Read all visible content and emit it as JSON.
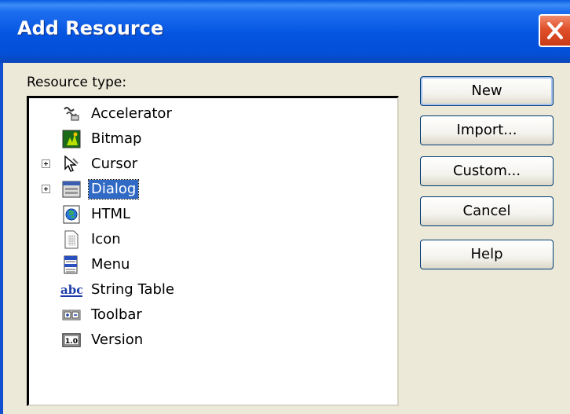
{
  "window": {
    "title": "Add Resource",
    "close_icon": "close-icon",
    "colors": {
      "title_bar": "#0454e0",
      "close": "#e0502a",
      "selection": "#316ac5",
      "face": "#ece9d8"
    }
  },
  "resource_type_label": "Resource type:",
  "tree": {
    "items": [
      {
        "label": "Accelerator",
        "icon": "accelerator-icon",
        "expandable": false,
        "selected": false
      },
      {
        "label": "Bitmap",
        "icon": "bitmap-icon",
        "expandable": false,
        "selected": false
      },
      {
        "label": "Cursor",
        "icon": "cursor-icon",
        "expandable": true,
        "selected": false
      },
      {
        "label": "Dialog",
        "icon": "dialog-icon",
        "expandable": true,
        "selected": true
      },
      {
        "label": "HTML",
        "icon": "html-icon",
        "expandable": false,
        "selected": false
      },
      {
        "label": "Icon",
        "icon": "icon-resource-icon",
        "expandable": false,
        "selected": false
      },
      {
        "label": "Menu",
        "icon": "menu-icon",
        "expandable": false,
        "selected": false
      },
      {
        "label": "String Table",
        "icon": "string-table-icon",
        "expandable": false,
        "selected": false
      },
      {
        "label": "Toolbar",
        "icon": "toolbar-icon",
        "expandable": false,
        "selected": false
      },
      {
        "label": "Version",
        "icon": "version-icon",
        "expandable": false,
        "selected": false
      }
    ]
  },
  "buttons": {
    "new": "New",
    "import": "Import...",
    "custom": "Custom...",
    "cancel": "Cancel",
    "help": "Help"
  }
}
